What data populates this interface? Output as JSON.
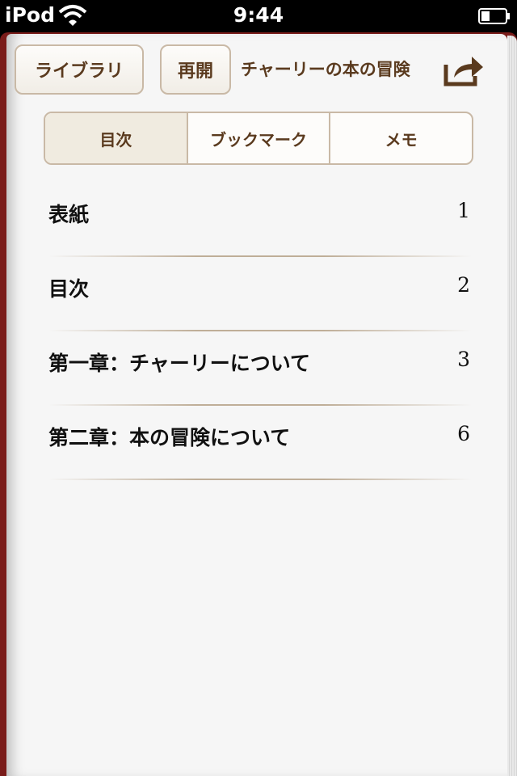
{
  "status_bar": {
    "carrier": "iPod",
    "time": "9:44"
  },
  "toolbar": {
    "library_label": "ライブラリ",
    "resume_label": "再開",
    "book_title": "チャーリーの本の冒険",
    "share_icon": "share-arrow-icon"
  },
  "tabs": [
    {
      "label": "目次",
      "selected": true
    },
    {
      "label": "ブックマーク",
      "selected": false
    },
    {
      "label": "メモ",
      "selected": false
    }
  ],
  "toc": [
    {
      "title": "表紙",
      "page": "1"
    },
    {
      "title": "目次",
      "page": "2"
    },
    {
      "title": "第一章：チャーリーについて",
      "page": "3"
    },
    {
      "title": "第二章：本の冒険について",
      "page": "6"
    }
  ],
  "colors": {
    "accent_brown": "#5a3a1e",
    "button_border": "#c9b9a6",
    "selected_tab": "#f0ebe0",
    "book_cover": "#7a1c1a",
    "page_background": "#f6f6f6"
  }
}
